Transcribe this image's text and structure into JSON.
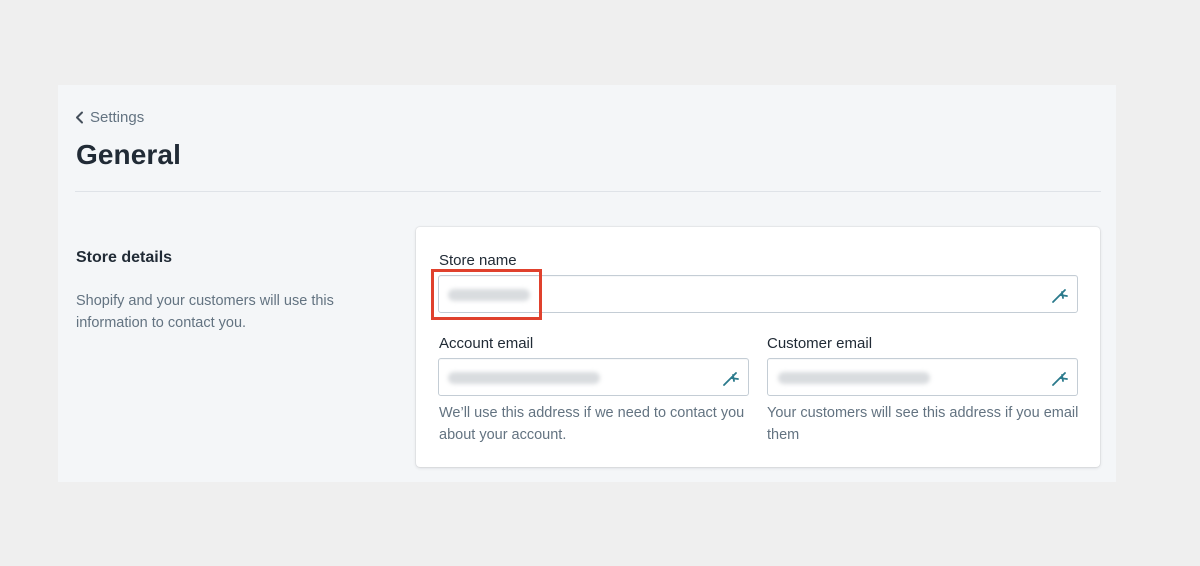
{
  "header": {
    "breadcrumb_label": "Settings",
    "title": "General"
  },
  "section": {
    "title": "Store details",
    "description": "Shopify and your customers will use this information to contact you."
  },
  "form": {
    "store_name": {
      "label": "Store name",
      "icon": "autofill-icon"
    },
    "account_email": {
      "label": "Account email",
      "help": "We’ll use this address if we need to contact you about your account.",
      "icon": "autofill-icon"
    },
    "customer_email": {
      "label": "Customer email",
      "help": "Your customers will see this address if you email them",
      "icon": "autofill-icon"
    }
  },
  "colors": {
    "highlight": "#e0412d",
    "icon_accent": "#2b7a8c"
  }
}
